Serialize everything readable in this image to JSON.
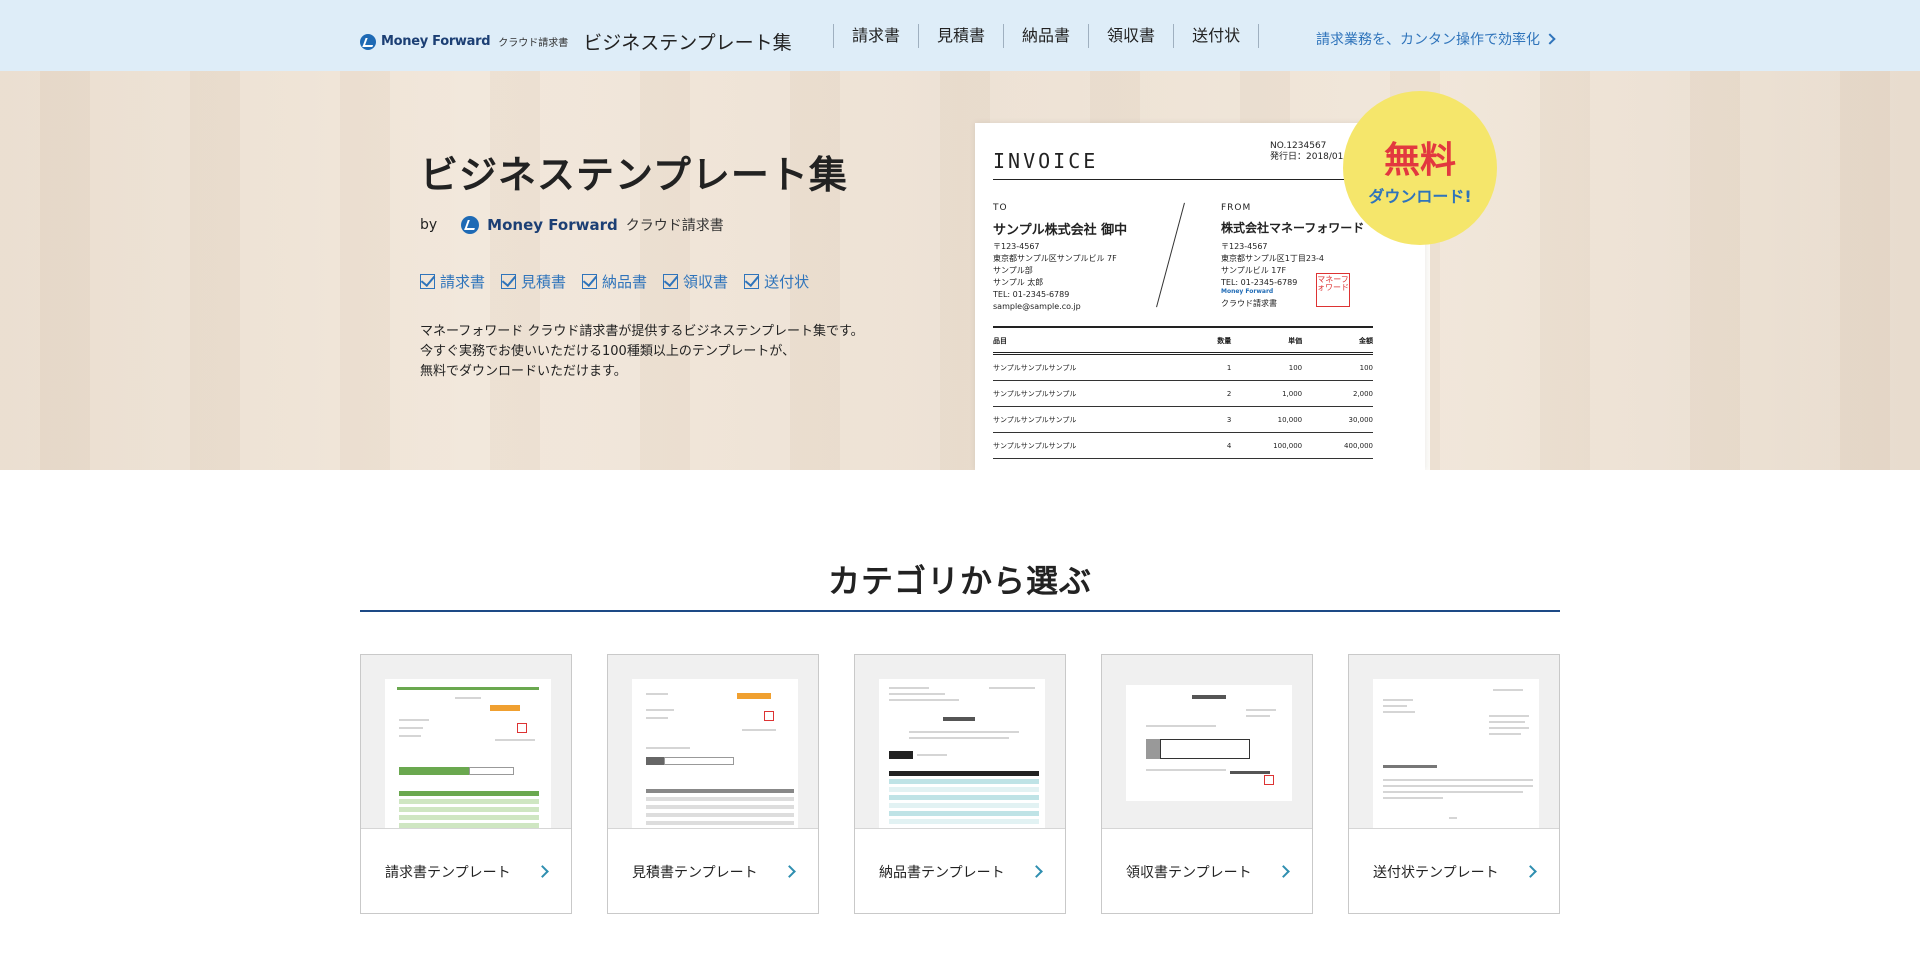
{
  "header": {
    "logo_word": "Money Forward",
    "logo_product": "クラウド請求書",
    "site_name": "ビジネステンプレート集",
    "nav": [
      {
        "label": "請求書"
      },
      {
        "label": "見積書"
      },
      {
        "label": "納品書"
      },
      {
        "label": "領収書"
      },
      {
        "label": "送付状"
      }
    ],
    "promo_link": "請求業務を、カンタン操作で効率化"
  },
  "hero": {
    "title": "ビジネステンプレート集",
    "by": "by",
    "brand_word": "Money Forward",
    "brand_product": "クラウド請求書",
    "checks": [
      "請求書",
      "見積書",
      "納品書",
      "領収書",
      "送付状"
    ],
    "desc": [
      "マネーフォワード クラウド請求書が提供するビジネステンプレート集です。",
      "今すぐ実務でお使いいただける100種類以上のテンプレートが、",
      "無料でダウンロードいただけます。"
    ],
    "badge_main": "無料",
    "badge_sub": "ダウンロード!",
    "invoice": {
      "title": "INVOICE",
      "no": "NO.1234567",
      "issued": "発行日：2018/01/0",
      "to_label": "TO",
      "to_name": "サンプル株式会社 御中",
      "to_addr": [
        "〒123-4567",
        "東京都サンプル区サンプルビル 7F",
        "サンプル部",
        "サンプル 太郎",
        "TEL: 01-2345-6789",
        "sample@sample.co.jp"
      ],
      "from_label": "FROM",
      "from_name": "株式会社マネーフォワード",
      "from_addr": [
        "〒123-4567",
        "東京都サンプル区1丁目23-4",
        "サンプルビル 17F",
        "TEL: 01-2345-6789"
      ],
      "from_product": "クラウド請求書",
      "mini_logo": "Money Forward",
      "stamp": "マネーフォワード",
      "columns": [
        "品目",
        "数量",
        "単価",
        "金額"
      ],
      "rows": [
        [
          "サンプルサンプルサンプル",
          "1",
          "100",
          "100"
        ],
        [
          "サンプルサンプルサンプル",
          "2",
          "1,000",
          "2,000"
        ],
        [
          "サンプルサンプルサンプル",
          "3",
          "10,000",
          "30,000"
        ],
        [
          "サンプルサンプルサンプル",
          "4",
          "100,000",
          "400,000"
        ]
      ]
    }
  },
  "categories": {
    "title": "カテゴリから選ぶ",
    "cards": [
      {
        "label": "請求書テンプレート"
      },
      {
        "label": "見積書テンプレート"
      },
      {
        "label": "納品書テンプレート"
      },
      {
        "label": "領収書テンプレート"
      },
      {
        "label": "送付状テンプレート"
      }
    ]
  },
  "colors": {
    "header_bg": "#deedf8",
    "accent_blue": "#2f74bb",
    "brand_navy": "#1c3f74",
    "badge_yellow": "#f5e66b",
    "badge_red": "#e2383f",
    "rule_navy": "#1d4a86"
  }
}
